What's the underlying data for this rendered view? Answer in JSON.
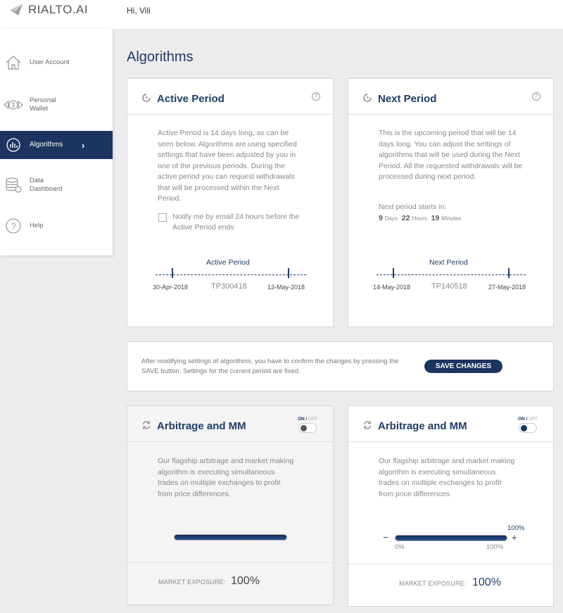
{
  "header": {
    "logo_text": "RIALTO.AI",
    "greeting": "Hi, Vili"
  },
  "sidebar": {
    "items": [
      {
        "label": "User Account",
        "icon": "home-icon"
      },
      {
        "label": "Personal Wallet",
        "icon": "wallet-icon"
      },
      {
        "label": "Algorithms",
        "icon": "algorithms-icon",
        "active": true
      },
      {
        "label": "Data Dashboard",
        "icon": "database-icon"
      },
      {
        "label": "Help",
        "icon": "help-icon"
      }
    ]
  },
  "page": {
    "title": "Algorithms"
  },
  "active_period": {
    "title": "Active Period",
    "description": "Active Period is 14 days long, as can be seen below. Algorithms are using specified settings that have been adjusted by you in one of the previous periods. During the active period you can request withdrawals that will be processed within the Next Period.",
    "notify_label": "Notify me by email 24 hours before the Active Period ends",
    "notify_checked": false,
    "timeline_title": "Active Period",
    "start_date": "30-Apr-2018",
    "code": "TP300418",
    "end_date": "13-May-2018"
  },
  "next_period": {
    "title": "Next Period",
    "description": "This is the upcoming period that will be 14 days long. You can adjust the settings of algorithms that will be used during the Next Period. All the requested withdrawals will be processed during next period.",
    "starts_label": "Next period starts in:",
    "countdown": {
      "days": "9",
      "days_unit": "Days",
      "hours": "22",
      "hours_unit": "Hours",
      "minutes": "19",
      "minutes_unit": "Minutes"
    },
    "timeline_title": "Next Period",
    "start_date": "14-May-2018",
    "code": "TP140518",
    "end_date": "27-May-2018"
  },
  "save": {
    "text": "After modifying settings of algorithms, you have to confirm the changes by pressing the SAVE button. Settings for the current period are fixed.",
    "button_label": "SAVE CHANGES"
  },
  "algo_active": {
    "title": "Arbitrage and MM",
    "on_label": "ON",
    "off_label": "OFF",
    "enabled": false,
    "description": "Our flagship arbitrage and market making algorithm is executing simultaneous trades on multiple exchanges to profit from price differences.",
    "exposure_fraction": 1.0,
    "exposure_label": "MARKET EXPOSURE:",
    "exposure_value": "100%"
  },
  "algo_next": {
    "title": "Arbitrage and MM",
    "on_label": "ON",
    "off_label": "OFF",
    "enabled": true,
    "description": "Our flagship arbitrage and market making algorithm is executing simultaneous trades on multiple exchanges to profit from price differences.",
    "slider_value_label": "100%",
    "slider_min_label": "0%",
    "slider_max_label": "100%",
    "minus": "−",
    "plus": "+",
    "exposure_fraction": 1.0,
    "exposure_label": "MARKET EXPOSURE:",
    "exposure_value": "100%"
  },
  "colors": {
    "brand_navy": "#1b3560",
    "title_blue": "#1f3c68",
    "background": "#ececec"
  }
}
